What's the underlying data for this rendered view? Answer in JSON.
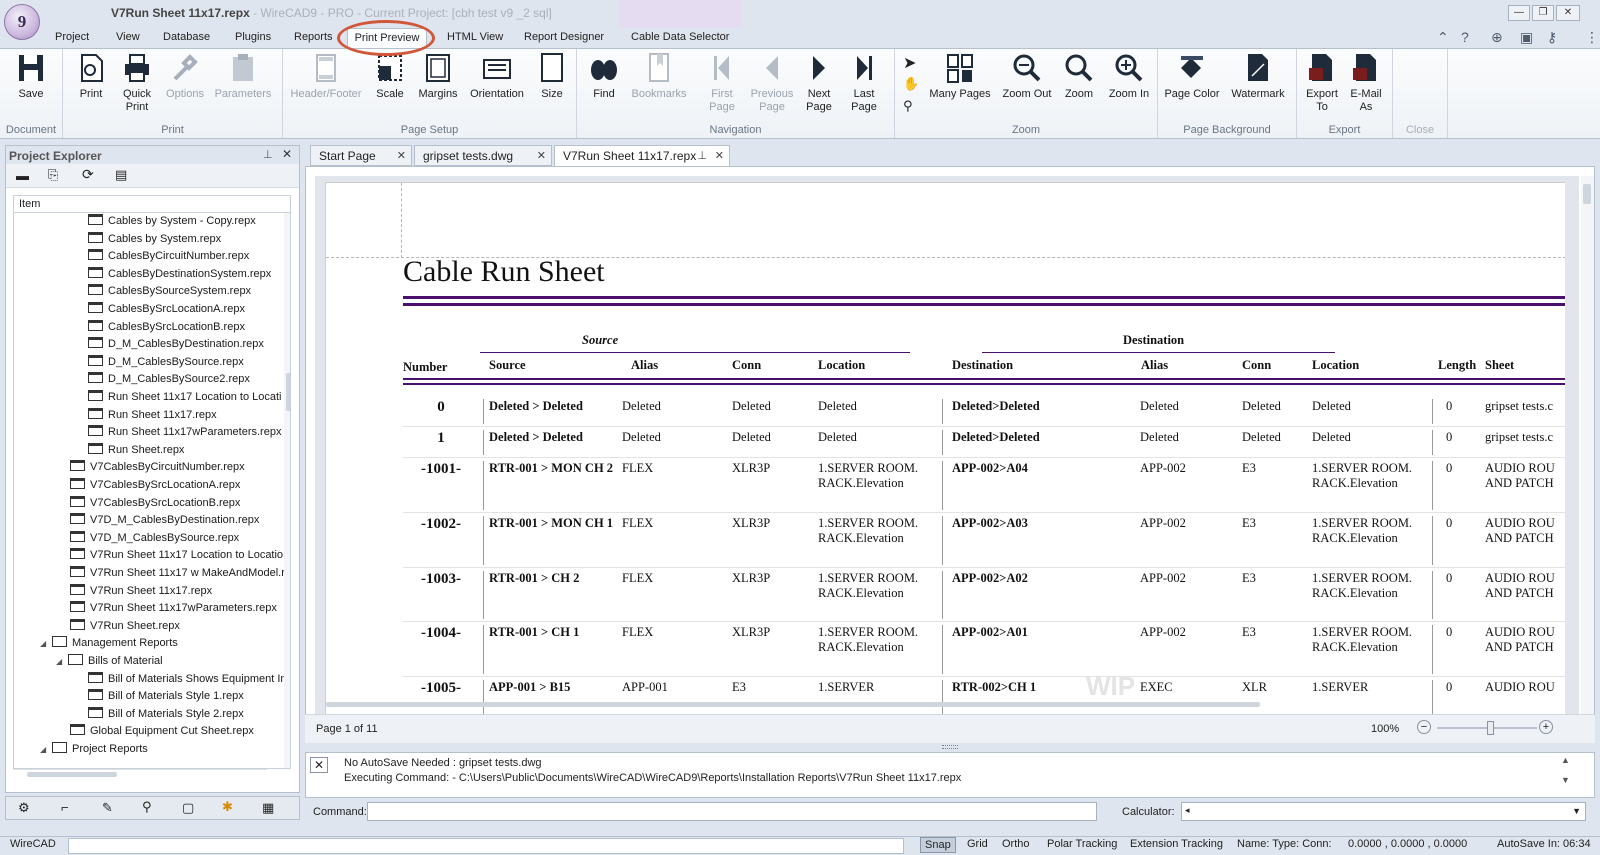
{
  "app": {
    "logo_text": "9",
    "title_doc": "V7Run Sheet 11x17.repx",
    "title_rest": " - WireCAD9 - PRO - Current Project: [cbh test v9 _2 sql]",
    "context_tab_color": "#e6dcf1"
  },
  "window_controls": {
    "minimize": "—",
    "restore": "❐",
    "close": "✕"
  },
  "ribbon_tabs": [
    "Project",
    "View",
    "Database",
    "Plugins",
    "Reports",
    "Print Preview",
    "HTML View",
    "Report Designer",
    "Cable Data Selector"
  ],
  "active_tab": "Print Preview",
  "ribbon": {
    "document": {
      "label": "Document",
      "save": "Save"
    },
    "print": {
      "label": "Print",
      "print": "Print",
      "quick_print": "Quick Print",
      "options": "Options",
      "parameters": "Parameters"
    },
    "page_setup": {
      "label": "Page Setup",
      "header_footer": "Header/Footer",
      "scale": "Scale",
      "margins": "Margins",
      "orientation": "Orientation",
      "size": "Size"
    },
    "navigation": {
      "label": "Navigation",
      "find": "Find",
      "bookmarks": "Bookmarks",
      "first_page": "First Page",
      "previous_page": "Previous Page",
      "next_page": "Next Page",
      "last_page": "Last Page"
    },
    "zoom": {
      "label": "Zoom",
      "many_pages": "Many Pages",
      "zoom_out": "Zoom Out",
      "zoom": "Zoom",
      "zoom_in": "Zoom In"
    },
    "page_background": {
      "label": "Page Background",
      "page_color": "Page Color",
      "watermark": "Watermark"
    },
    "export": {
      "label": "Export",
      "export_to": "Export To",
      "email_as": "E-Mail As"
    },
    "close": {
      "label": "Close"
    }
  },
  "project_explorer": {
    "title": "Project Explorer",
    "column_header": "Item",
    "items": [
      {
        "label": "Cables by System - Copy.repx",
        "type": "file",
        "level": 4
      },
      {
        "label": "Cables by System.repx",
        "type": "file",
        "level": 4
      },
      {
        "label": "CablesByCircuitNumber.repx",
        "type": "file",
        "level": 4
      },
      {
        "label": "CablesByDestinationSystem.repx",
        "type": "file",
        "level": 4
      },
      {
        "label": "CablesBySourceSystem.repx",
        "type": "file",
        "level": 4
      },
      {
        "label": "CablesBySrcLocationA.repx",
        "type": "file",
        "level": 4
      },
      {
        "label": "CablesBySrcLocationB.repx",
        "type": "file",
        "level": 4
      },
      {
        "label": "D_M_CablesByDestination.repx",
        "type": "file",
        "level": 4
      },
      {
        "label": "D_M_CablesBySource.repx",
        "type": "file",
        "level": 4
      },
      {
        "label": "D_M_CablesBySource2.repx",
        "type": "file",
        "level": 4
      },
      {
        "label": "Run Sheet 11x17 Location to Locati",
        "type": "file",
        "level": 4
      },
      {
        "label": "Run Sheet 11x17.repx",
        "type": "file",
        "level": 4
      },
      {
        "label": "Run Sheet 11x17wParameters.repx",
        "type": "file",
        "level": 4
      },
      {
        "label": "Run Sheet.repx",
        "type": "file",
        "level": 4
      },
      {
        "label": "V7CablesByCircuitNumber.repx",
        "type": "file",
        "level": 3
      },
      {
        "label": "V7CablesBySrcLocationA.repx",
        "type": "file",
        "level": 3
      },
      {
        "label": "V7CablesBySrcLocationB.repx",
        "type": "file",
        "level": 3
      },
      {
        "label": "V7D_M_CablesByDestination.repx",
        "type": "file",
        "level": 3
      },
      {
        "label": "V7D_M_CablesBySource.repx",
        "type": "file",
        "level": 3
      },
      {
        "label": "V7Run Sheet 11x17 Location to Locatio",
        "type": "file",
        "level": 3
      },
      {
        "label": "V7Run Sheet 11x17 w MakeAndModel.r",
        "type": "file",
        "level": 3
      },
      {
        "label": "V7Run Sheet 11x17.repx",
        "type": "file",
        "level": 3
      },
      {
        "label": "V7Run Sheet 11x17wParameters.repx",
        "type": "file",
        "level": 3
      },
      {
        "label": "V7Run Sheet.repx",
        "type": "file",
        "level": 3
      },
      {
        "label": "Management Reports",
        "type": "folder",
        "level": 1
      },
      {
        "label": "Bills of Material",
        "type": "folder",
        "level": 2
      },
      {
        "label": "Bill of Materials Shows Equipment In",
        "type": "file",
        "level": 4
      },
      {
        "label": "Bill of Materials Style 1.repx",
        "type": "file",
        "level": 4
      },
      {
        "label": "Bill of Materials Style 2.repx",
        "type": "file",
        "level": 4
      },
      {
        "label": "Global Equipment Cut Sheet.repx",
        "type": "file",
        "level": 3
      },
      {
        "label": "Project Reports",
        "type": "folder",
        "level": 1
      }
    ]
  },
  "doc_tabs": [
    "Start Page",
    "gripset tests.dwg",
    "V7Run Sheet 11x17.repx"
  ],
  "active_doc": "V7Run Sheet 11x17.repx",
  "report": {
    "title": "Cable Run Sheet",
    "group_source": "Source",
    "group_destination": "Destination",
    "headers": {
      "number": "Number",
      "source": "Source",
      "alias": "Alias",
      "conn": "Conn",
      "location": "Location",
      "destination": "Destination",
      "d_alias": "Alias",
      "d_conn": "Conn",
      "d_location": "Location",
      "length": "Length",
      "sheet": "Sheet"
    },
    "rows": [
      {
        "number": "0",
        "source": "Deleted > Deleted",
        "alias": "Deleted",
        "conn": "Deleted",
        "location": "Deleted",
        "destination": "Deleted>Deleted",
        "d_alias": "Deleted",
        "d_conn": "Deleted",
        "d_location": "Deleted",
        "length": "0",
        "sheet": "gripset tests.c"
      },
      {
        "number": "1",
        "source": "Deleted > Deleted",
        "alias": "Deleted",
        "conn": "Deleted",
        "location": "Deleted",
        "destination": "Deleted>Deleted",
        "d_alias": "Deleted",
        "d_conn": "Deleted",
        "d_location": "Deleted",
        "length": "0",
        "sheet": "gripset tests.c"
      },
      {
        "number": "-1001-",
        "source": "RTR-001 > MON CH 2",
        "alias": "FLEX",
        "conn": "XLR3P",
        "location": "1.SERVER ROOM.RACK.Elevation",
        "destination": "APP-002>A04",
        "d_alias": "APP-002",
        "d_conn": "E3",
        "d_location": "1.SERVER ROOM.RACK.Elevation",
        "length": "0",
        "sheet": "AUDIO ROU AND PATCH"
      },
      {
        "number": "-1002-",
        "source": "RTR-001 > MON CH 1",
        "alias": "FLEX",
        "conn": "XLR3P",
        "location": "1.SERVER ROOM.RACK.Elevation",
        "destination": "APP-002>A03",
        "d_alias": "APP-002",
        "d_conn": "E3",
        "d_location": "1.SERVER ROOM.RACK.Elevation",
        "length": "0",
        "sheet": "AUDIO ROU AND PATCH"
      },
      {
        "number": "-1003-",
        "source": "RTR-001 > CH 2",
        "alias": "FLEX",
        "conn": "XLR3P",
        "location": "1.SERVER ROOM.RACK.Elevation",
        "destination": "APP-002>A02",
        "d_alias": "APP-002",
        "d_conn": "E3",
        "d_location": "1.SERVER ROOM.RACK.Elevation",
        "length": "0",
        "sheet": "AUDIO ROU AND PATCH"
      },
      {
        "number": "-1004-",
        "source": "RTR-001 > CH 1",
        "alias": "FLEX",
        "conn": "XLR3P",
        "location": "1.SERVER ROOM.RACK.Elevation",
        "destination": "APP-002>A01",
        "d_alias": "APP-002",
        "d_conn": "E3",
        "d_location": "1.SERVER ROOM.RACK.Elevation",
        "length": "0",
        "sheet": "AUDIO ROU AND PATCH"
      },
      {
        "number": "-1005-",
        "source": "APP-001 > B15",
        "alias": "APP-001",
        "conn": "E3",
        "location": "1.SERVER",
        "destination": "RTR-002>CH 1",
        "d_alias": "EXEC",
        "d_conn": "XLR",
        "d_location": "1.SERVER",
        "length": "0",
        "sheet": "AUDIO ROU"
      }
    ],
    "watermark_text": "WIP"
  },
  "preview_status": {
    "page": "Page 1 of 11",
    "zoom": "100%",
    "zoom_fraction": 0.53
  },
  "output": {
    "line1": "No AutoSave Needed : gripset tests.dwg",
    "line2": "Executing Command:  - C:\\Users\\Public\\Documents\\WireCAD\\WireCAD9\\Reports\\Installation Reports\\V7Run Sheet 11x17.repx"
  },
  "command": {
    "label": "Command:",
    "value": "",
    "calculator_label": "Calculator:"
  },
  "status_bar": {
    "app": "WireCAD",
    "toggles": [
      "Snap",
      "Grid",
      "Ortho",
      "Polar Tracking",
      "Extension Tracking"
    ],
    "name_type_conn": "Name:  Type:  Conn:",
    "coords": "0.0000 , 0.0000 , 0.0000",
    "autosave": "AutoSave In: 06:34"
  },
  "colors": {
    "accent_purple": "#4b0f6c",
    "highlight_circle": "#d0573a",
    "ribbon_icon": "#1f2a3a"
  }
}
